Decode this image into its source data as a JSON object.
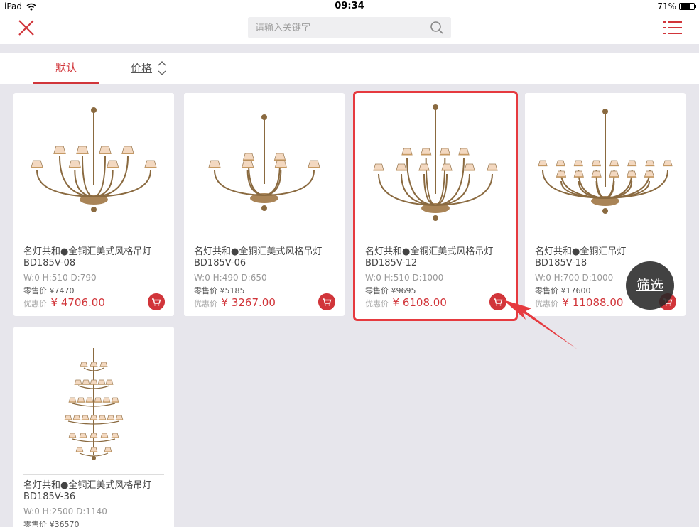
{
  "status": {
    "device": "iPad",
    "time": "09:34",
    "battery": "71%",
    "battery_level": 0.71
  },
  "header": {
    "search_placeholder": "请输入关键字"
  },
  "sort": {
    "default_label": "默认",
    "price_label": "价格"
  },
  "labels": {
    "retail": "零售价",
    "promo": "优惠价",
    "currency": "¥"
  },
  "filter": {
    "label": "筛选"
  },
  "products": [
    {
      "name": "名灯共和●全铜汇美式风格吊灯",
      "model": "BD185V-08",
      "dims": "W:0 H:510 D:790",
      "retail": "7470",
      "promo": "4706.00"
    },
    {
      "name": "名灯共和●全铜汇美式风格吊灯",
      "model": "BD185V-06",
      "dims": "W:0 H:490 D:650",
      "retail": "5185",
      "promo": "3267.00"
    },
    {
      "name": "名灯共和●全铜汇美式风格吊灯",
      "model": "BD185V-12",
      "dims": "W:0 H:510 D:1000",
      "retail": "9695",
      "promo": "6108.00"
    },
    {
      "name": "名灯共和●全铜汇吊灯",
      "model": "BD185V-18",
      "dims": "W:0 H:700 D:1000",
      "retail": "17600",
      "promo": "11088.00"
    },
    {
      "name": "名灯共和●全铜汇美式风格吊灯",
      "model": "BD185V-36",
      "dims": "W:0 H:2500 D:1140",
      "retail": "36570",
      "promo": ""
    }
  ]
}
